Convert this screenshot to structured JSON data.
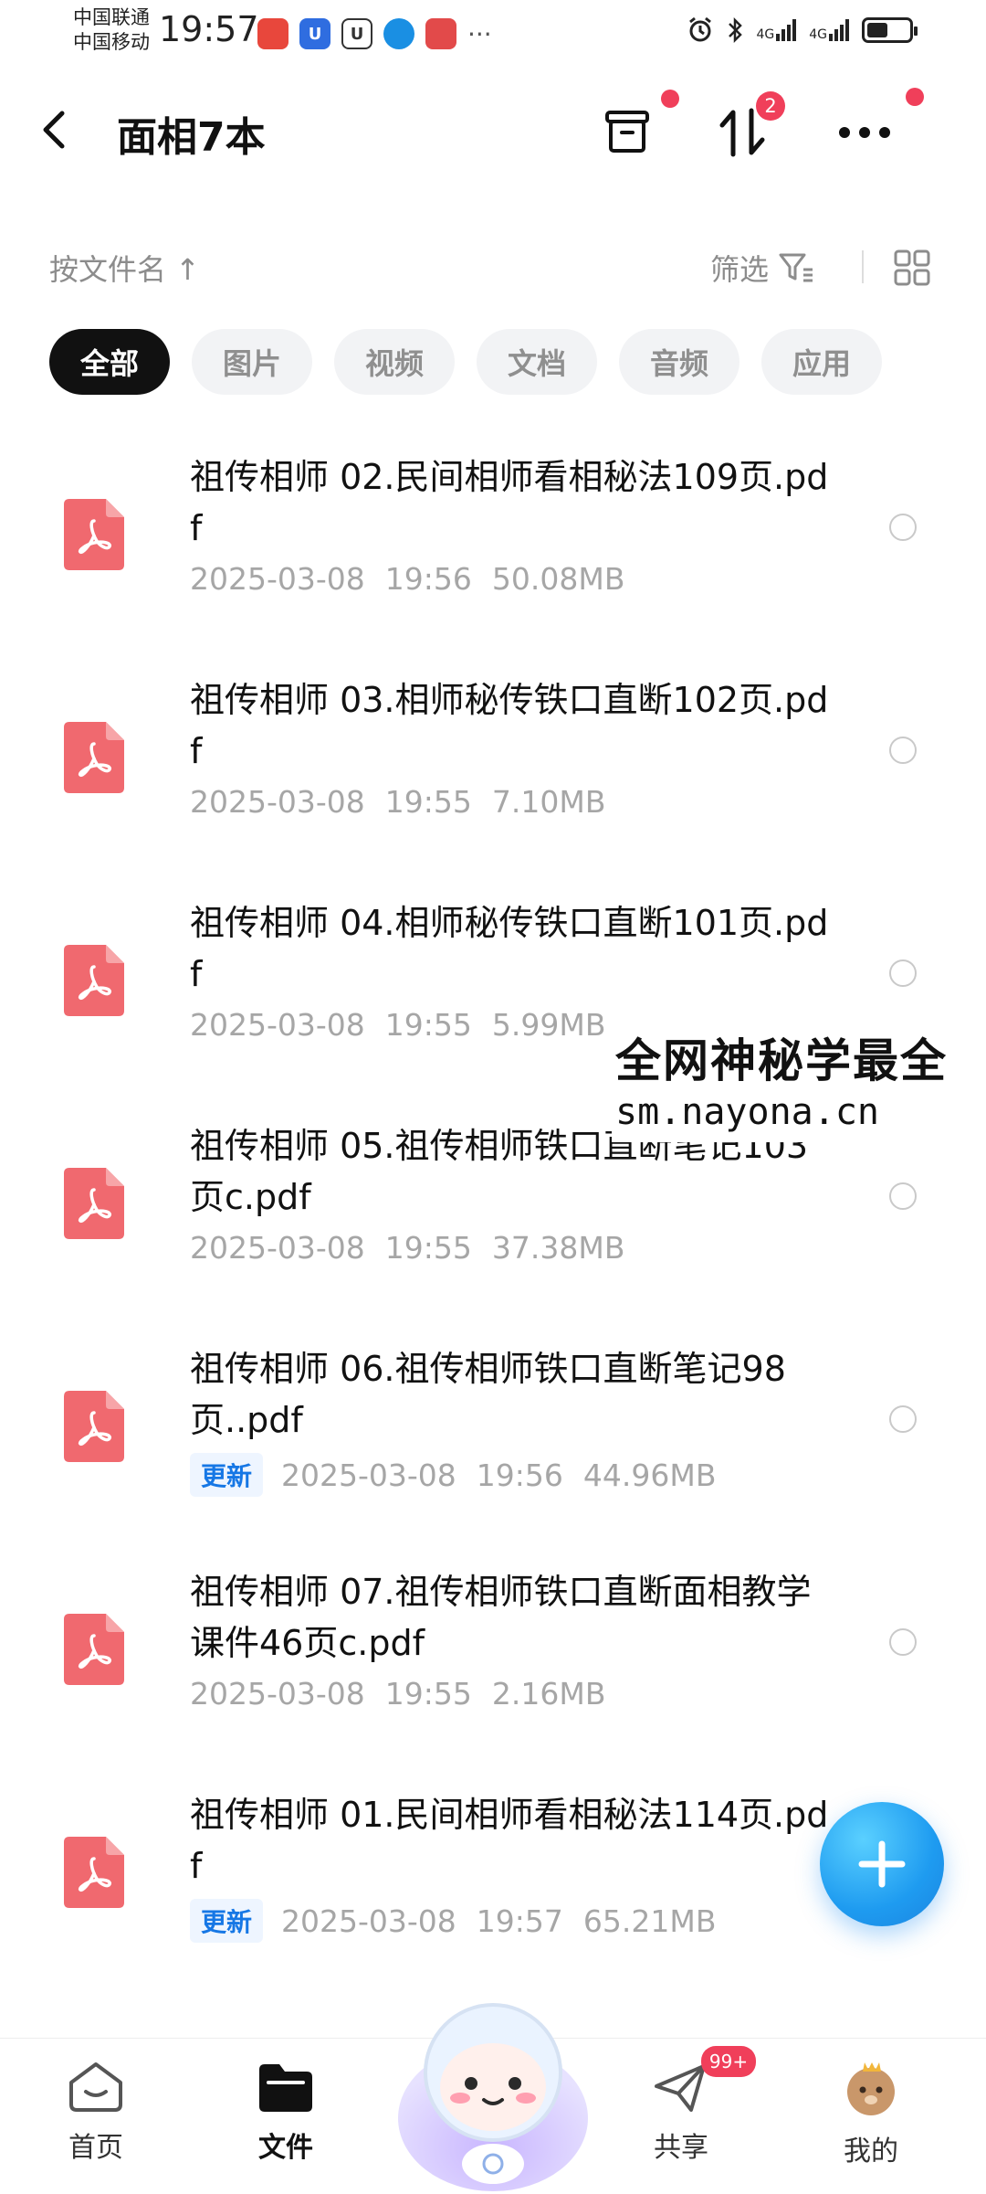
{
  "status_bar": {
    "carrier1": "中国联通",
    "carrier2": "中国移动",
    "time": "19:57",
    "net1": "4G",
    "net2": "4G"
  },
  "header": {
    "title": "面相7本",
    "sort_badge": "2"
  },
  "toolbar": {
    "sort_label": "按文件名 ↑",
    "filter_label": "筛选"
  },
  "chips": [
    {
      "label": "全部",
      "active": true
    },
    {
      "label": "图片"
    },
    {
      "label": "视频"
    },
    {
      "label": "文档"
    },
    {
      "label": "音频"
    },
    {
      "label": "应用"
    }
  ],
  "files": [
    {
      "name": "祖传相师 02.民间相师看相秘法109页.pdf",
      "date": "2025-03-08",
      "time": "19:56",
      "size": "50.08MB",
      "tag": ""
    },
    {
      "name": "祖传相师 03.相师秘传铁口直断102页.pdf",
      "date": "2025-03-08",
      "time": "19:55",
      "size": "7.10MB",
      "tag": ""
    },
    {
      "name": "祖传相师 04.相师秘传铁口直断101页.pdf",
      "date": "2025-03-08",
      "time": "19:55",
      "size": "5.99MB",
      "tag": ""
    },
    {
      "name": "祖传相师 05.祖传相师铁口直断笔记103页c.pdf",
      "date": "2025-03-08",
      "time": "19:55",
      "size": "37.38MB",
      "tag": ""
    },
    {
      "name": "祖传相师 06.祖传相师铁口直断笔记98页..pdf",
      "date": "2025-03-08",
      "time": "19:56",
      "size": "44.96MB",
      "tag": "更新"
    },
    {
      "name": "祖传相师 07.祖传相师铁口直断面相教学课件46页c.pdf",
      "date": "2025-03-08",
      "time": "19:55",
      "size": "2.16MB",
      "tag": ""
    },
    {
      "name": "祖传相师  01.民间相师看相秘法114页.pdf",
      "date": "2025-03-08",
      "time": "19:57",
      "size": "65.21MB",
      "tag": "更新"
    }
  ],
  "watermark": {
    "line1": "全网神秘学最全",
    "line2": "sm.nayona.cn"
  },
  "bottom_nav": {
    "home": "首页",
    "files": "文件",
    "share": "共享",
    "share_badge": "99+",
    "mine": "我的"
  },
  "colors": {
    "accent_blue": "#1e9bf0",
    "pdf_red": "#f0696f",
    "badge_red": "#f03f5a"
  }
}
